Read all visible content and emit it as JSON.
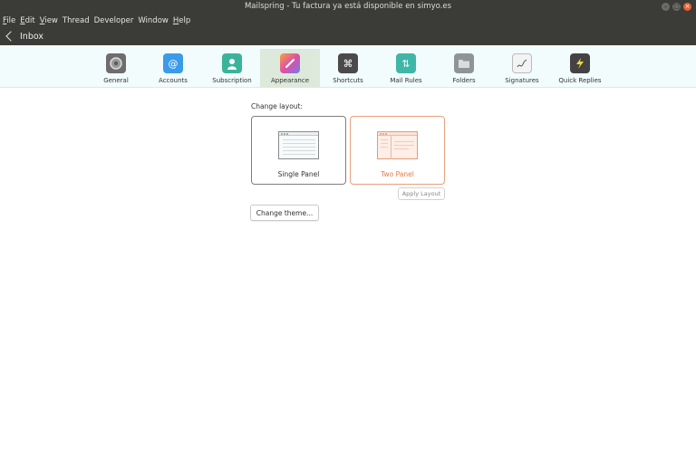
{
  "window": {
    "title": "Mailspring - Tu factura ya está disponible en simyo.es"
  },
  "menu": [
    {
      "first": "F",
      "rest": "ile"
    },
    {
      "first": "E",
      "rest": "dit"
    },
    {
      "first": "V",
      "rest": "iew"
    },
    {
      "first": "",
      "rest": "Thread"
    },
    {
      "first": "",
      "rest": "Developer"
    },
    {
      "first": "",
      "rest": "Window"
    },
    {
      "first": "H",
      "rest": "elp"
    }
  ],
  "nav": {
    "back_label": "Inbox"
  },
  "tabs": [
    {
      "label": "General",
      "icon": "gear-icon",
      "color": "#6d6d6d",
      "glyph": "⚙"
    },
    {
      "label": "Accounts",
      "icon": "at-icon",
      "color": "#3c9be8",
      "glyph": "@"
    },
    {
      "label": "Subscription",
      "icon": "person-icon",
      "color": "#3bb39b",
      "glyph": "👤"
    },
    {
      "label": "Appearance",
      "icon": "palette-icon",
      "color": "#d96ad0",
      "glyph": "✎"
    },
    {
      "label": "Shortcuts",
      "icon": "command-icon",
      "color": "#4a4a4a",
      "glyph": "⌘"
    },
    {
      "label": "Mail Rules",
      "icon": "rules-icon",
      "color": "#3fb6a8",
      "glyph": "⇅"
    },
    {
      "label": "Folders",
      "icon": "folder-icon",
      "color": "#8f9596",
      "glyph": "▭"
    },
    {
      "label": "Signatures",
      "icon": "signature-icon",
      "color": "#f3f3f3",
      "glyph": "✍"
    },
    {
      "label": "Quick Replies",
      "icon": "quick-reply-icon",
      "color": "#434343",
      "glyph": "⚡"
    }
  ],
  "active_tab": "Appearance",
  "appearance": {
    "layout_label": "Change layout:",
    "single_panel": "Single Panel",
    "two_panel": "Two Panel",
    "selected_layout": "Two Panel",
    "apply_label": "Apply Layout",
    "theme_label": "Change theme..."
  }
}
